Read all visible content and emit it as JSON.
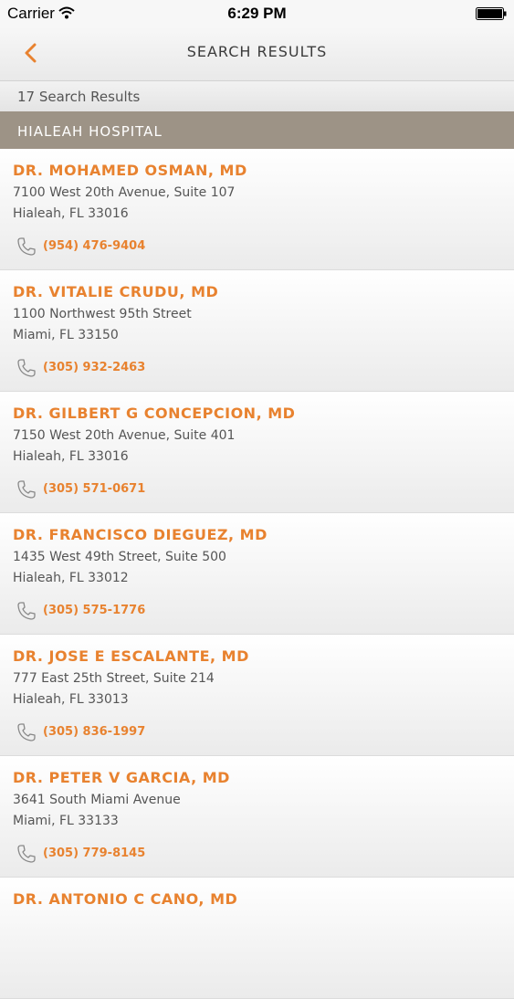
{
  "status_bar": {
    "carrier": "Carrier",
    "time": "6:29 PM"
  },
  "nav": {
    "title": "SEARCH RESULTS",
    "back_icon": "chevron-left-icon"
  },
  "results": {
    "count_label": "17 Search Results"
  },
  "section": {
    "title": "HIALEAH HOSPITAL"
  },
  "colors": {
    "accent": "#e8822f",
    "section_bg": "#9d9386"
  },
  "doctors": [
    {
      "name": "DR. MOHAMED OSMAN, MD",
      "address1": "7100 West 20th Avenue, Suite 107",
      "address2": "Hialeah, FL 33016",
      "phone": "(954) 476-9404"
    },
    {
      "name": "DR. VITALIE CRUDU, MD",
      "address1": "1100 Northwest 95th Street",
      "address2": "Miami, FL 33150",
      "phone": "(305) 932-2463"
    },
    {
      "name": "DR. GILBERT G CONCEPCION, MD",
      "address1": "7150 West 20th Avenue, Suite 401",
      "address2": "Hialeah, FL 33016",
      "phone": "(305) 571-0671"
    },
    {
      "name": "DR. FRANCISCO DIEGUEZ, MD",
      "address1": "1435 West 49th Street, Suite 500",
      "address2": "Hialeah, FL 33012",
      "phone": "(305) 575-1776"
    },
    {
      "name": "DR. JOSE E ESCALANTE, MD",
      "address1": "777 East 25th Street, Suite 214",
      "address2": "Hialeah, FL 33013",
      "phone": "(305) 836-1997"
    },
    {
      "name": "DR. PETER V GARCIA, MD",
      "address1": "3641 South Miami Avenue",
      "address2": "Miami, FL 33133",
      "phone": "(305) 779-8145"
    },
    {
      "name": "DR. ANTONIO C CANO, MD"
    }
  ]
}
